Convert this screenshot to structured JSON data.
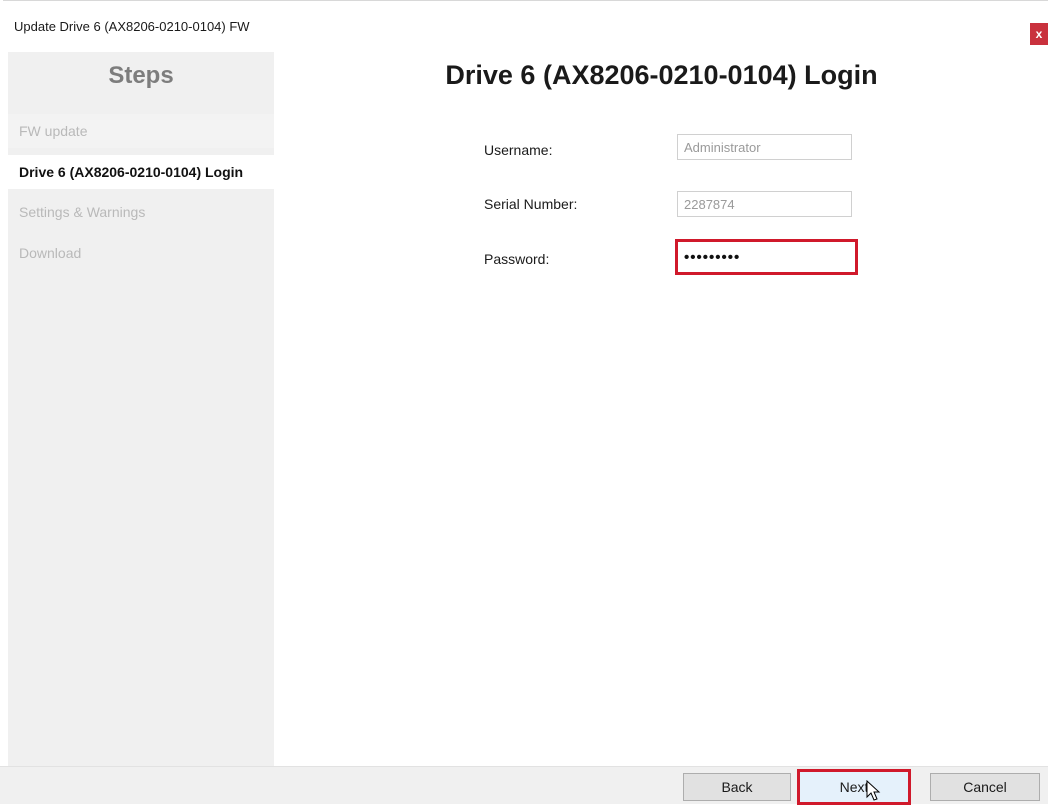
{
  "window": {
    "title": "Update Drive 6 (AX8206-0210-0104) FW",
    "close_label": "x"
  },
  "sidebar": {
    "heading": "Steps",
    "steps": [
      {
        "label": "FW update",
        "state": "done"
      },
      {
        "label": "Drive 6 (AX8206-0210-0104) Login",
        "state": "current"
      },
      {
        "label": "Settings & Warnings",
        "state": "pending"
      },
      {
        "label": "Download",
        "state": "pending"
      }
    ],
    "scroll_left_arrow": "‹",
    "scroll_right_arrow": "›"
  },
  "main": {
    "title": "Drive 6 (AX8206-0210-0104) Login",
    "fields": {
      "username": {
        "label": "Username:",
        "value": "Administrator"
      },
      "serial": {
        "label": "Serial Number:",
        "value": "2287874"
      },
      "password": {
        "label": "Password:",
        "value": "•••••••••"
      }
    }
  },
  "footer": {
    "back_label": "Back",
    "next_label": "Next",
    "cancel_label": "Cancel"
  },
  "colors": {
    "highlight": "#d0192b",
    "close": "#c9313d",
    "sidebar_bg": "#f0f0f0"
  },
  "icons": {
    "cursor": "pointer-cursor-icon"
  }
}
